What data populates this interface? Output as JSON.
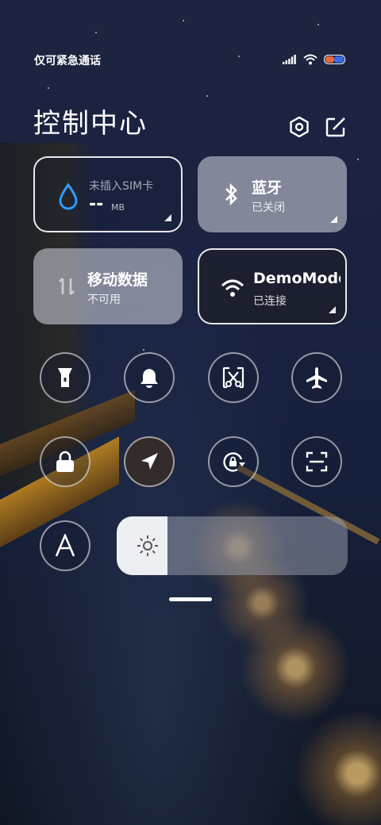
{
  "status_bar": {
    "carrier_text": "仅可紧急通话",
    "signal_icon": "signal-bars-icon",
    "wifi_icon": "wifi-icon",
    "battery_icon": "battery-icon"
  },
  "header": {
    "title": "控制中心",
    "settings_icon": "settings-hex-icon",
    "edit_icon": "edit-icon"
  },
  "tiles": {
    "data_usage": {
      "label": "未插入SIM卡",
      "value": "--",
      "unit": "MB",
      "icon": "water-drop-icon",
      "icon_color": "#2f9cff"
    },
    "bluetooth": {
      "label": "蓝牙",
      "status": "已关闭",
      "icon": "bluetooth-icon"
    },
    "mobile_data": {
      "label": "移动数据",
      "status": "不可用",
      "icon": "mobile-data-icon"
    },
    "wifi": {
      "label": "DemoMode",
      "status": "已连接",
      "icon": "wifi-icon"
    }
  },
  "toggles": [
    {
      "name": "flashlight",
      "icon": "flashlight-icon",
      "active": false
    },
    {
      "name": "mute",
      "icon": "bell-icon",
      "active": false
    },
    {
      "name": "screenshot",
      "icon": "scissors-icon",
      "active": false
    },
    {
      "name": "airplane-mode",
      "icon": "airplane-icon",
      "active": false
    },
    {
      "name": "lock-screen",
      "icon": "lock-icon",
      "active": false
    },
    {
      "name": "location",
      "icon": "location-arrow-icon",
      "active": false
    },
    {
      "name": "rotation-lock",
      "icon": "rotation-lock-icon",
      "active": false
    },
    {
      "name": "scanner",
      "icon": "scan-icon",
      "active": false
    },
    {
      "name": "auto-brightness",
      "icon": "font-a-icon",
      "active": false
    }
  ],
  "brightness": {
    "level": 0.22,
    "icon": "sun-icon"
  },
  "colors": {
    "accent": "#2f9cff",
    "tile_light": "#c8ccd6"
  }
}
